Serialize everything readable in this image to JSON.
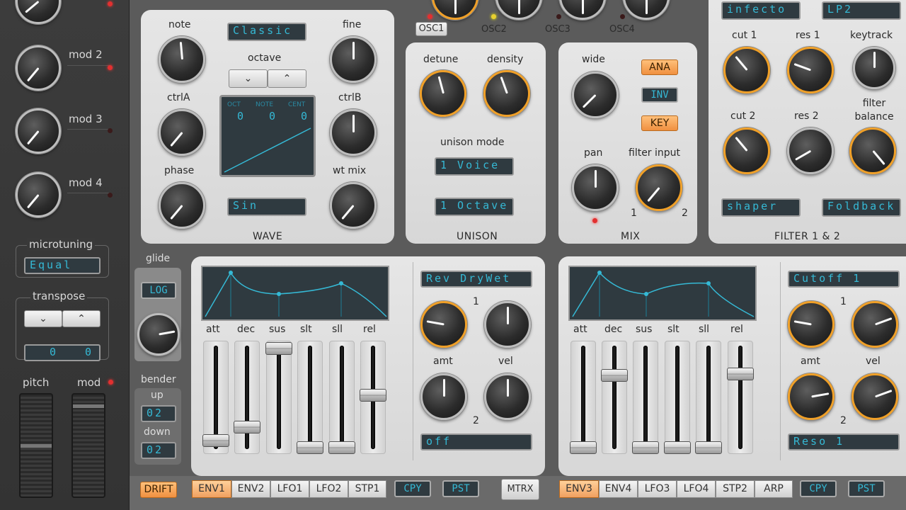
{
  "left": {
    "mod_labels": [
      "mod 2",
      "mod 3",
      "mod 4"
    ],
    "microtuning_label": "microtuning",
    "microtuning_value": "Equal",
    "transpose_label": "transpose",
    "transpose_values": [
      "0",
      "0"
    ],
    "pitch_label": "pitch",
    "mod_label": "mod"
  },
  "osc": {
    "note": "note",
    "fine": "fine",
    "octave": "octave",
    "ctrlA": "ctrlA",
    "ctrlB": "ctrlB",
    "phase": "phase",
    "wt_mix": "wt mix",
    "wavetable": "Classic",
    "wave": "Sin",
    "title": "WAVE",
    "display_headers": [
      "OCT",
      "NOTE",
      "CENT"
    ],
    "display_values": [
      "0",
      "0",
      "0"
    ]
  },
  "osc_tabs": [
    "OSC1",
    "OSC2",
    "OSC3",
    "OSC4"
  ],
  "unison": {
    "detune": "detune",
    "density": "density",
    "mode_label": "unison mode",
    "mode": "1 Voice",
    "octave": "1 Octave",
    "title": "UNISON"
  },
  "mix": {
    "wide": "wide",
    "pan": "pan",
    "filter_input": "filter input",
    "in1": "1",
    "in2": "2",
    "title": "MIX",
    "buttons": [
      "ANA",
      "INV",
      "KEY"
    ]
  },
  "filter": {
    "type1": "infecto",
    "type2": "LP2",
    "cut1": "cut 1",
    "res1": "res 1",
    "keytrack": "keytrack",
    "cut2": "cut 2",
    "res2": "res 2",
    "balance": "filter balance",
    "shaper": "shaper",
    "foldback": "Foldback",
    "title": "FILTER 1 & 2"
  },
  "glide": {
    "label": "glide",
    "mode": "LOG",
    "bender": "bender",
    "up": "up",
    "up_value": "02",
    "down": "down",
    "down_value": "02"
  },
  "env_left": {
    "labels": [
      "att",
      "dec",
      "sus",
      "slt",
      "sll",
      "rel"
    ],
    "target": "Rev DryWet",
    "target2": "off",
    "amt": "amt",
    "vel": "vel",
    "n1": "1",
    "n2": "2"
  },
  "env_right": {
    "labels": [
      "att",
      "dec",
      "sus",
      "slt",
      "sll",
      "rel"
    ],
    "target": "Cutoff 1",
    "target2": "Reso 1",
    "amt": "amt",
    "vel": "vel",
    "n1": "1",
    "n2": "2"
  },
  "bottom": {
    "drift": "DRIFT",
    "tabs_left": [
      "ENV1",
      "ENV2",
      "LFO1",
      "LFO2",
      "STP1"
    ],
    "copy": "CPY",
    "paste": "PST",
    "matrix": "MTRX",
    "tabs_right": [
      "ENV3",
      "ENV4",
      "LFO3",
      "LFO4",
      "STP2",
      "ARP"
    ]
  },
  "colors": {
    "accent": "#f0a028",
    "lcd_text": "#35b9d5",
    "lcd_bg": "#2f3a40"
  }
}
